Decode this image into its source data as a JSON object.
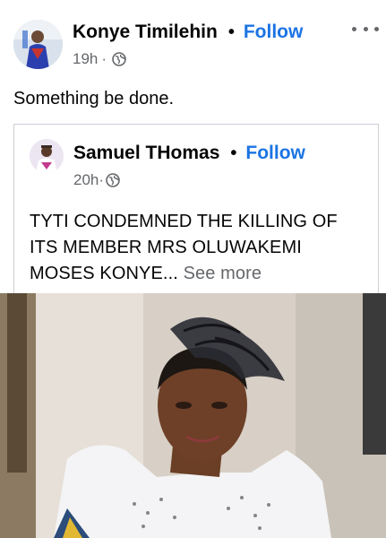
{
  "post": {
    "author": "Konye Timilehin",
    "separator": "•",
    "follow_label": "Follow",
    "time": "19h",
    "meta_sep": "·",
    "privacy_icon": "globe-icon",
    "more_icon": "more-options-icon",
    "text": "Something be done."
  },
  "shared_post": {
    "author": "Samuel THomas",
    "separator": "•",
    "follow_label": "Follow",
    "time": "20h",
    "meta_sep": "·",
    "privacy_icon": "globe-icon",
    "text": "TYTI CONDEMNED THE KILLING OF ITS MEMBER MRS OLUWAKEMI MOSES KONYE...",
    "see_more_label": "See more"
  },
  "colors": {
    "link_blue": "#1b74e4",
    "secondary_text": "#65676b",
    "primary_text": "#050505",
    "border": "#ccd0d5"
  }
}
